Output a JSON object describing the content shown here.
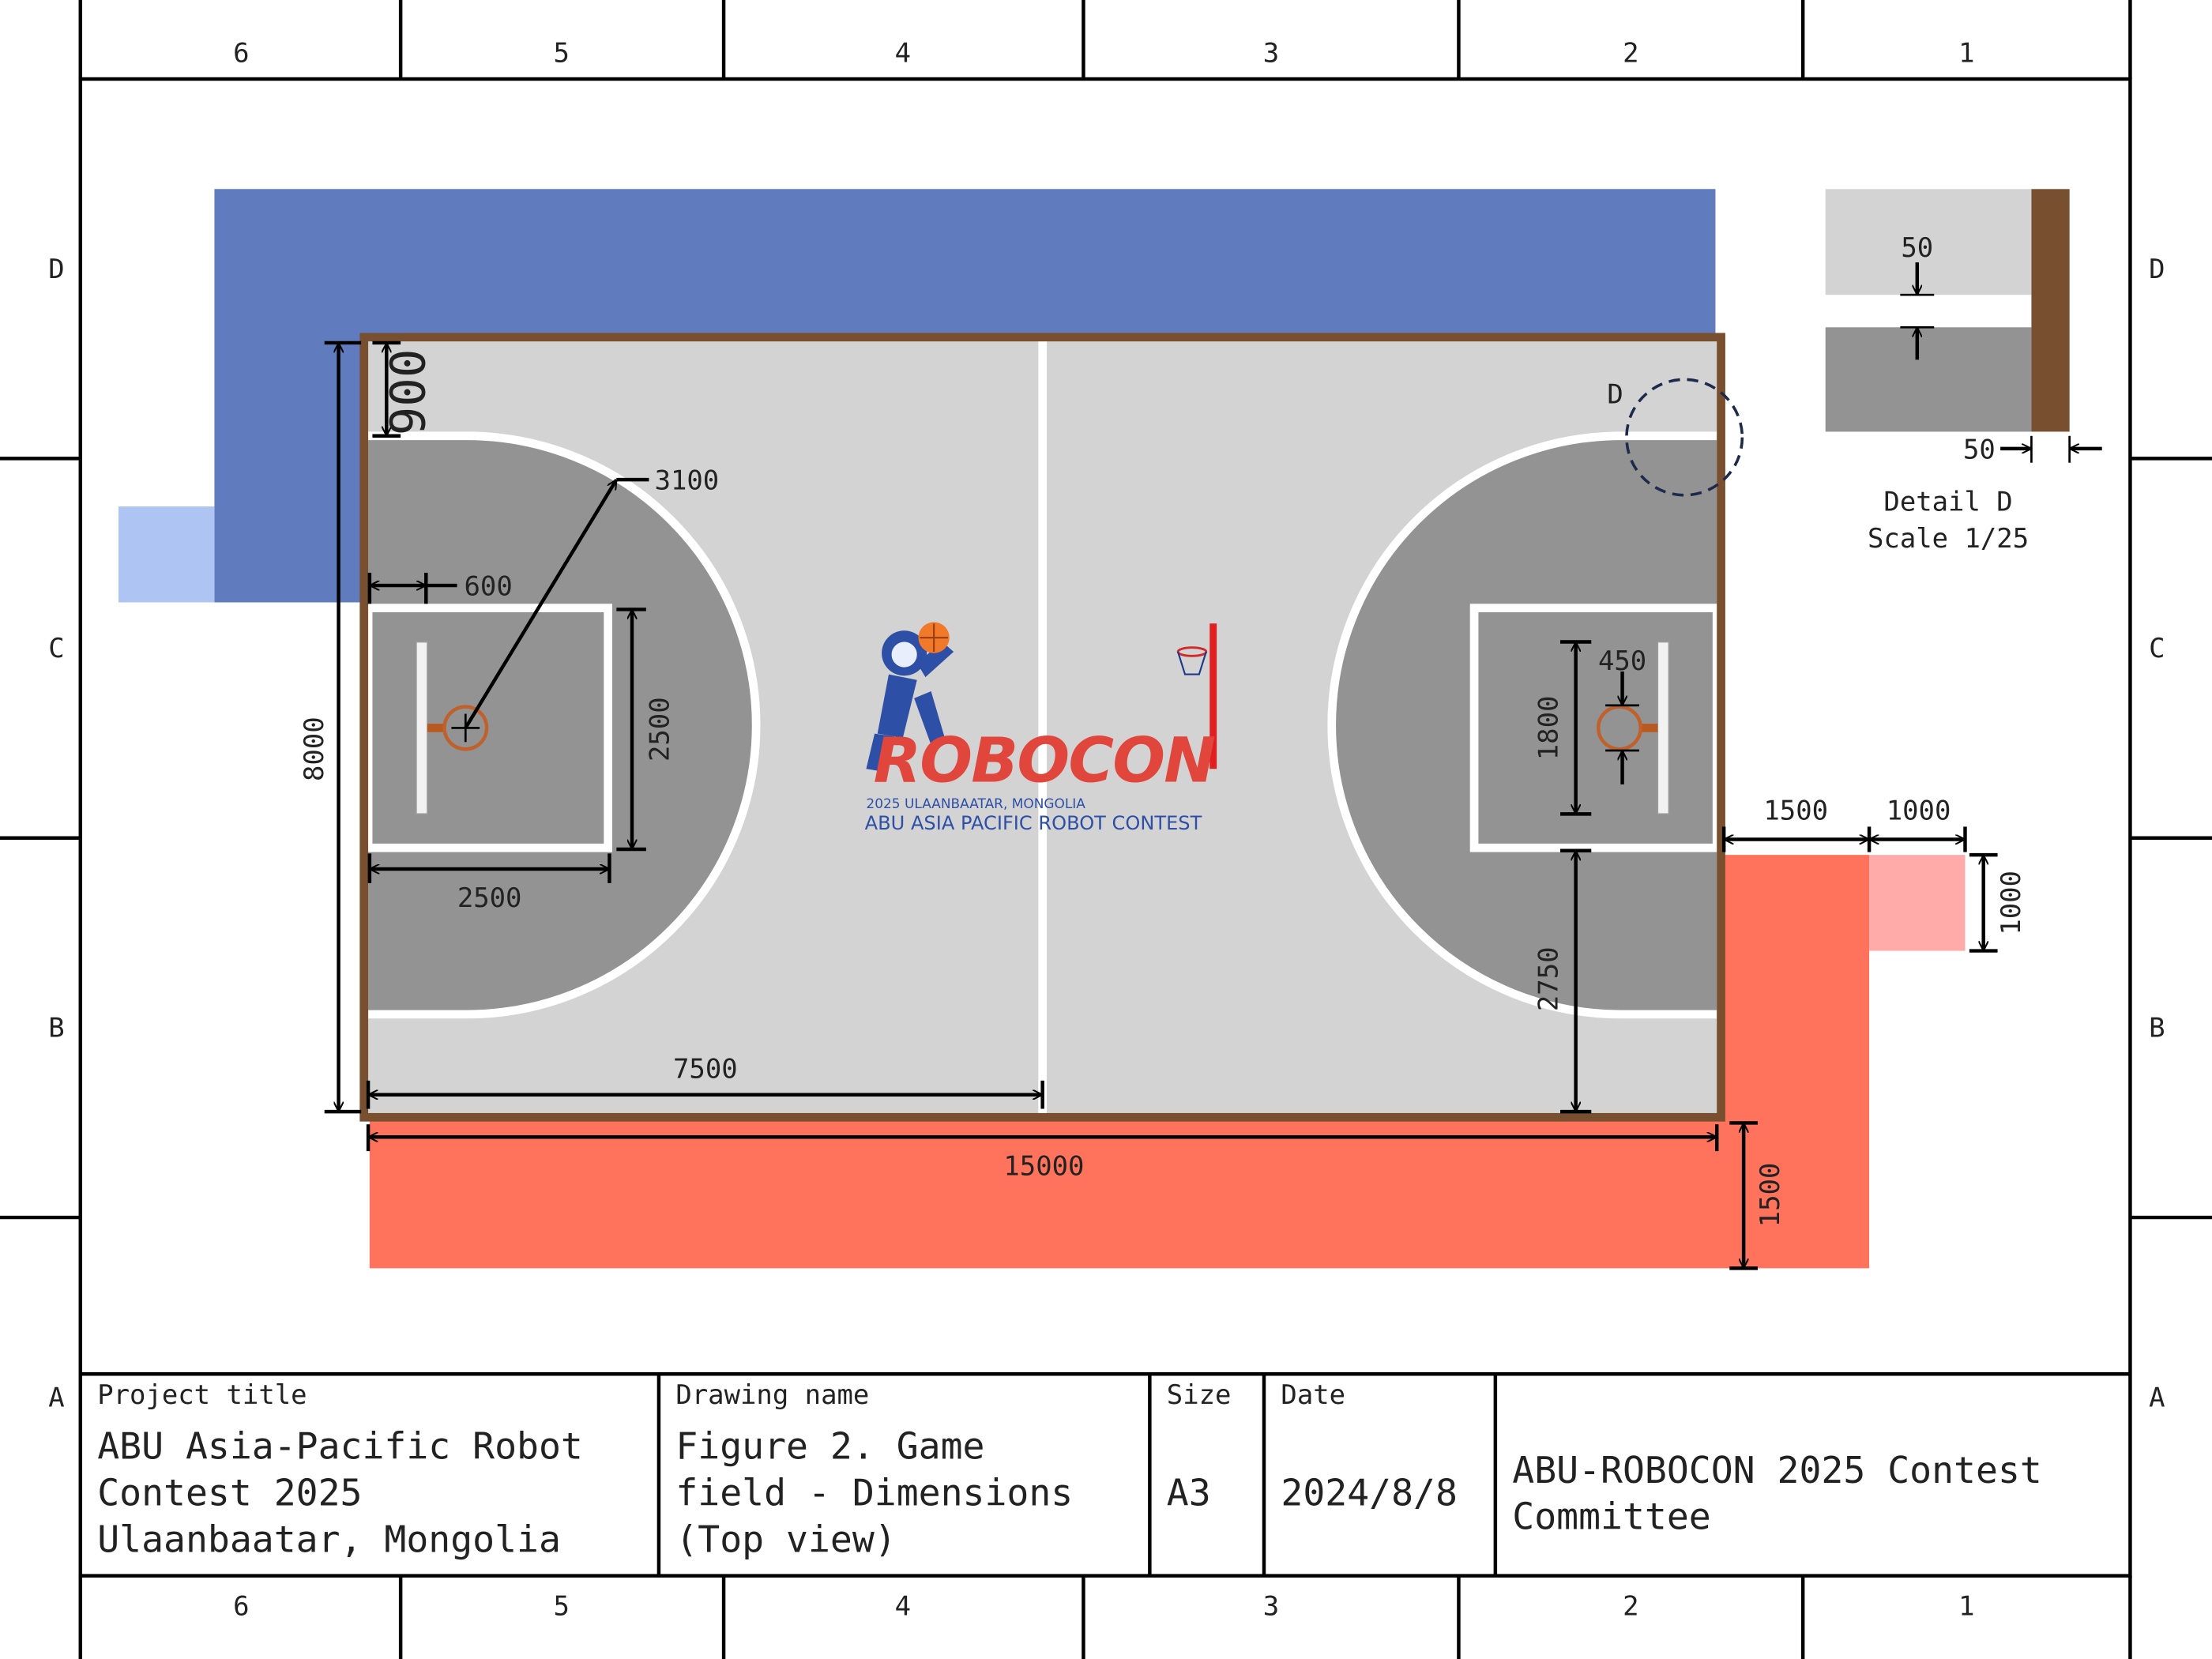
{
  "drawing": {
    "column_labels": [
      "6",
      "5",
      "4",
      "3",
      "2",
      "1"
    ],
    "row_labels": [
      "D",
      "C",
      "B",
      "A"
    ],
    "colors": {
      "blue_zone": "#617bbf",
      "blue_start": "#aec4f2",
      "red_zone": "#ff735c",
      "red_start": "#ffabaa",
      "court_light": "#d3d3d3",
      "court_dark": "#939393",
      "fence": "#785030",
      "lines": "#ffffff"
    },
    "dimensions": {
      "d_900": "900",
      "d_3100": "3100",
      "d_600": "600",
      "d_2500_v": "2500",
      "d_2500_h": "2500",
      "d_8000": "8000",
      "d_7500": "7500",
      "d_15000": "15000",
      "d_450": "450",
      "d_1800": "1800",
      "d_2750": "2750",
      "d_1500_h": "1500",
      "d_1000_h": "1000",
      "d_1000_v": "1000",
      "d_1500_v": "1500"
    },
    "detail": {
      "marker": "D",
      "d_50_top": "50",
      "d_50_side": "50",
      "title": "Detail D",
      "scale": "Scale 1/25"
    },
    "logo": {
      "word": "ROBOCON",
      "line1": "2025 ULAANBAATAR, MONGOLIA",
      "line2": "ABU ASIA PACIFIC ROBOT CONTEST"
    }
  },
  "title_block": {
    "project_title_label": "Project title",
    "project_title_lines": [
      "ABU Asia-Pacific Robot",
      "Contest 2025",
      "Ulaanbaatar, Mongolia"
    ],
    "drawing_name_label": "Drawing name",
    "drawing_name_lines": [
      "Figure 2. Game",
      "field - Dimensions",
      "(Top view)"
    ],
    "size_label": "Size",
    "size_value": "A3",
    "date_label": "Date",
    "date_value": "2024/8/8",
    "organization_lines": [
      "ABU-ROBOCON 2025 Contest",
      "Committee"
    ]
  }
}
